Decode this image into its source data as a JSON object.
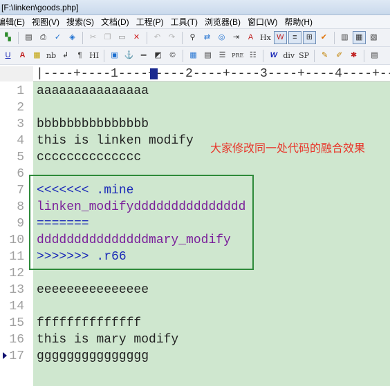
{
  "window": {
    "title": "[F:\\linken\\goods.php]"
  },
  "menu": [
    "编辑(E)",
    "视图(V)",
    "搜索(S)",
    "文档(D)",
    "工程(P)",
    "工具(T)",
    "浏览器(B)",
    "窗口(W)",
    "帮助(H)"
  ],
  "toolbar2_text": {
    "hx": "Hx",
    "nb": "nb",
    "hi": "HI",
    "div": "div",
    "sp": "SP",
    "pre": "PRE"
  },
  "ruler": {
    "text": "|----+----1----+----2----+----3----+----4----+--"
  },
  "editor": {
    "lines": [
      {
        "num": "1",
        "text": "aaaaaaaaaaaaaaa"
      },
      {
        "num": "2",
        "text": ""
      },
      {
        "num": "3",
        "text": "bbbbbbbbbbbbbbb"
      },
      {
        "num": "4",
        "text": "this is linken modify"
      },
      {
        "num": "5",
        "text": "cccccccccccccc"
      },
      {
        "num": "6",
        "text": ""
      },
      {
        "num": "7",
        "text": "<<<<<<< .mine"
      },
      {
        "num": "8",
        "text": "linken_modifyddddddddddddddd"
      },
      {
        "num": "9",
        "text": "======="
      },
      {
        "num": "10",
        "text": "dddddddddddddddmary_modify"
      },
      {
        "num": "11",
        "text": ">>>>>>> .r66"
      },
      {
        "num": "12",
        "text": ""
      },
      {
        "num": "13",
        "text": "eeeeeeeeeeeeeee"
      },
      {
        "num": "14",
        "text": ""
      },
      {
        "num": "15",
        "text": "ffffffffffffff"
      },
      {
        "num": "16",
        "text": "this is mary modify"
      },
      {
        "num": "17",
        "text": "ggggggggggggggg"
      }
    ]
  },
  "annotation": {
    "text": "大家修改同一处代码的融合效果"
  },
  "colors": {
    "editor_bg": "#cfe7cf",
    "box": "#2e8a3a",
    "note": "#e8352a",
    "marker": "#1c2bb8",
    "conflict_text": "#7a1f9a"
  }
}
